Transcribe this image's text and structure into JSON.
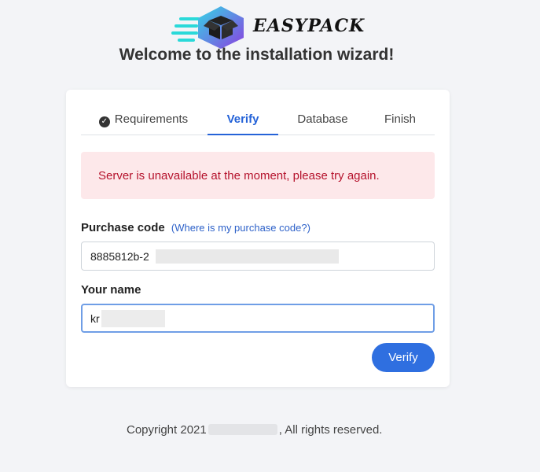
{
  "app": {
    "brand": "EASYPACK",
    "welcome": "Welcome to the installation wizard!"
  },
  "tabs": [
    {
      "label": "Requirements",
      "done": true
    },
    {
      "label": "Verify",
      "active": true
    },
    {
      "label": "Database"
    },
    {
      "label": "Finish"
    }
  ],
  "alert": {
    "message": "Server is unavailable at the moment, please try again."
  },
  "form": {
    "purchase_code_label": "Purchase code",
    "purchase_code_help": "(Where is my purchase code?)",
    "purchase_code_value": "8885812b-2",
    "name_label": "Your name",
    "name_value": "kr",
    "verify_label": "Verify"
  },
  "footer": {
    "prefix": "Copyright 2021",
    "suffix": ", All rights reserved."
  },
  "colors": {
    "accent": "#2f6fe0",
    "alert_bg": "#fde8ea",
    "alert_text": "#b5122c",
    "background": "#f3f4f7"
  },
  "icons": {
    "logo": "box-speed-icon",
    "requirements_done": "check-circle-icon"
  }
}
